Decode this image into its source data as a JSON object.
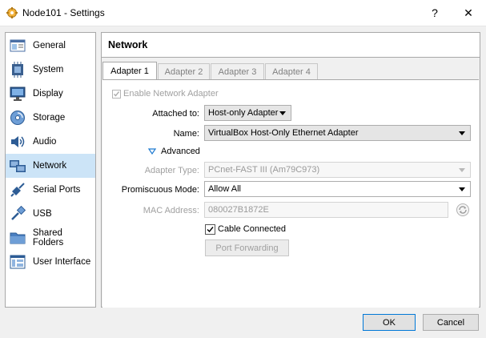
{
  "window": {
    "title": "Node101 - Settings",
    "help_glyph": "?",
    "close_glyph": "✕"
  },
  "sidebar": {
    "items": [
      {
        "label": "General",
        "icon": "general-icon"
      },
      {
        "label": "System",
        "icon": "system-icon"
      },
      {
        "label": "Display",
        "icon": "display-icon"
      },
      {
        "label": "Storage",
        "icon": "storage-icon"
      },
      {
        "label": "Audio",
        "icon": "audio-icon"
      },
      {
        "label": "Network",
        "icon": "network-icon",
        "selected": true
      },
      {
        "label": "Serial Ports",
        "icon": "serial-ports-icon"
      },
      {
        "label": "USB",
        "icon": "usb-icon"
      },
      {
        "label": "Shared Folders",
        "icon": "shared-folders-icon"
      },
      {
        "label": "User Interface",
        "icon": "user-interface-icon"
      }
    ]
  },
  "page": {
    "title": "Network",
    "tabs": [
      {
        "label": "Adapter 1",
        "active": true
      },
      {
        "label": "Adapter 2"
      },
      {
        "label": "Adapter 3"
      },
      {
        "label": "Adapter 4"
      }
    ]
  },
  "adapter": {
    "enable_label": "Enable Network Adapter",
    "enable_checked": true,
    "attached_label": "Attached to:",
    "attached_value": "Host-only Adapter",
    "name_label": "Name:",
    "name_value": "VirtualBox Host-Only Ethernet Adapter",
    "advanced_label": "Advanced",
    "adapter_type_label": "Adapter Type:",
    "adapter_type_value": "PCnet-FAST III (Am79C973)",
    "promiscuous_label": "Promiscuous Mode:",
    "promiscuous_value": "Allow All",
    "mac_label": "MAC Address:",
    "mac_value": "080027B1872E",
    "cable_label": "Cable Connected",
    "cable_checked": true,
    "port_forwarding_label": "Port Forwarding"
  },
  "footer": {
    "ok_label": "OK",
    "cancel_label": "Cancel"
  },
  "colors": {
    "selection": "#cce4f7",
    "accent": "#0078d7"
  }
}
